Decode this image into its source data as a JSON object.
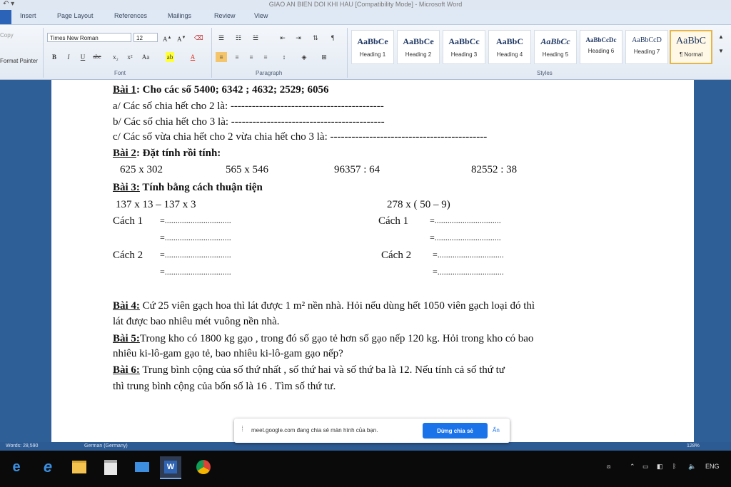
{
  "window": {
    "title": "GIAO AN BIEN DOI KHI HAU [Compatibility Mode] - Microsoft Word"
  },
  "ribbon": {
    "tabs": [
      "Insert",
      "Page Layout",
      "References",
      "Mailings",
      "Review",
      "View"
    ],
    "clipboard": {
      "format_painter": "Format Painter",
      "copy": "Copy"
    },
    "font": {
      "name": "Times New Roman",
      "size": "12",
      "label": "Font"
    },
    "paragraph": {
      "label": "Paragraph"
    },
    "styles": {
      "label": "Styles",
      "items": [
        {
          "sample": "AaBbCe",
          "name": "Heading 1"
        },
        {
          "sample": "AaBbCe",
          "name": "Heading 2"
        },
        {
          "sample": "AaBbCc",
          "name": "Heading 3"
        },
        {
          "sample": "AaBbC",
          "name": "Heading 4"
        },
        {
          "sample": "AaBbCc",
          "name": "Heading 5"
        },
        {
          "sample": "AaBbCcDc",
          "name": "Heading 6"
        },
        {
          "sample": "AaBbCcD",
          "name": "Heading 7"
        },
        {
          "sample": "AaBbC",
          "name": "¶ Normal"
        }
      ]
    }
  },
  "doc": {
    "bai1_label": "Bài 1",
    "bai1_text": ": Cho các số 5400; 6342 ; 4632; 2529; 6056",
    "bai1_a": "a/ Các số chia hết cho 2 là: -------------------------------------------",
    "bai1_b": "b/ Các số chia hết cho 3 là: -------------------------------------------",
    "bai1_c": "c/ Các số vừa chia hết cho 2 vừa chia hết cho 3 là: --------------------------------------------",
    "bai2_label": "Bài 2",
    "bai2_text": ": Đặt tính rồi tính:",
    "bai2_exprs": [
      "625  x 302",
      "565 x  546",
      "96357 : 64",
      "82552 : 38"
    ],
    "bai3_label": "Bài 3:",
    "bai3_text": " Tính bằng cách thuận tiện",
    "bai3_left_expr": "137 x 13 – 137 x 3",
    "bai3_right_expr": "278 x ( 50 – 9)",
    "cach1": "Cách 1",
    "cach2": "Cách 2",
    "fill": "=...............................",
    "bai4_label": "Bài 4:",
    "bai4_text1": " Cứ 25 viên gạch hoa thì lát được 1 m² nền nhà. Hỏi nếu dùng hết 1050 viên gạch loại đó thì",
    "bai4_text2": "lát được bao nhiêu mét vuông nền nhà.",
    "bai5_label": "Bài 5:",
    "bai5_text1": "Trong kho có 1800 kg gạo , trong đó số gạo tẻ hơn số gạo nếp 120 kg. Hỏi trong kho có bao",
    "bai5_text2": "nhiêu ki-lô-gam gạo tẻ, bao nhiêu ki-lô-gam gạo nếp?",
    "bai6_label": "Bài 6:",
    "bai6_text1": " Trung bình cộng của số thứ nhất , số thứ hai và số thứ ba là 12. Nếu tính cả số thứ tư",
    "bai6_text2": "thì trung bình cộng của bốn số là 16 . Tìm số thứ tư."
  },
  "statusbar": {
    "words": "Words: 28,590",
    "language": "German (Germany)",
    "zoom": "128%"
  },
  "share_bar": {
    "message": "meet.google.com đang chia sẻ màn hình của bạn.",
    "stop_label": "Dừng chia sẻ",
    "hide_label": "Ẩn"
  },
  "tray": {
    "language": "ENG"
  }
}
